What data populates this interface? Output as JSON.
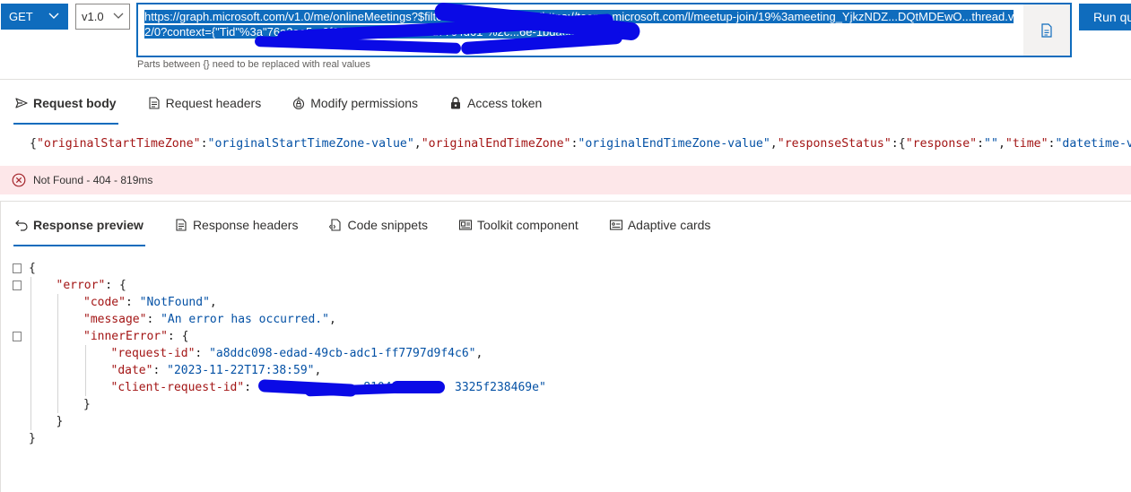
{
  "query_bar": {
    "method": "GET",
    "version": "v1.0",
    "url": "https://graph.microsoft.com/v1.0/me/onlineMeetings?$filter=JoinWebUrl+eq+'https://teams.microsoft.com/l/meetup-join/19%3ameeting_YjkzNDZ...DQtMDEwO...thread.v2/0?context={\"Tid\"%3a\"76a2ae5a-9f00-4f6b-95ed-5d33d77c4d61\"%2c...6e-1bdac35800dd\"}'",
    "hint": "Parts between {} need to be replaced with real values",
    "run_label": "Run query"
  },
  "request_tabs": [
    {
      "label": "Request body",
      "icon": "send-icon",
      "active": true
    },
    {
      "label": "Request headers",
      "icon": "document-icon",
      "active": false
    },
    {
      "label": "Modify permissions",
      "icon": "lock-shield-icon",
      "active": false
    },
    {
      "label": "Access token",
      "icon": "lock-icon",
      "active": false
    }
  ],
  "request_body": {
    "parts": [
      {
        "t": "{",
        "c": "p"
      },
      {
        "t": "\"originalStartTimeZone\"",
        "c": "k"
      },
      {
        "t": ":",
        "c": "p"
      },
      {
        "t": "\"originalStartTimeZone-value\"",
        "c": "s"
      },
      {
        "t": ",",
        "c": "p"
      },
      {
        "t": "\"originalEndTimeZone\"",
        "c": "k"
      },
      {
        "t": ":",
        "c": "p"
      },
      {
        "t": "\"originalEndTimeZone-value\"",
        "c": "s"
      },
      {
        "t": ",",
        "c": "p"
      },
      {
        "t": "\"responseStatus\"",
        "c": "k"
      },
      {
        "t": ":{",
        "c": "p"
      },
      {
        "t": "\"response\"",
        "c": "k"
      },
      {
        "t": ":",
        "c": "p"
      },
      {
        "t": "\"\"",
        "c": "s"
      },
      {
        "t": ",",
        "c": "p"
      },
      {
        "t": "\"time\"",
        "c": "k"
      },
      {
        "t": ":",
        "c": "p"
      },
      {
        "t": "\"datetime-value\"",
        "c": "s"
      }
    ]
  },
  "status": {
    "text": "Not Found - 404 - 819ms",
    "color": "#fde7e9"
  },
  "response_tabs": [
    {
      "label": "Response preview",
      "icon": "undo-arrow-icon",
      "active": true
    },
    {
      "label": "Response headers",
      "icon": "document-icon",
      "active": false
    },
    {
      "label": "Code snippets",
      "icon": "code-file-icon",
      "active": false
    },
    {
      "label": "Toolkit component",
      "icon": "toolkit-icon",
      "active": false
    },
    {
      "label": "Adaptive cards",
      "icon": "card-icon",
      "active": false
    }
  ],
  "response_json": {
    "lines": [
      {
        "indent": 0,
        "fold": true,
        "tokens": [
          {
            "t": "{",
            "c": "pun"
          }
        ]
      },
      {
        "indent": 1,
        "fold": true,
        "tokens": [
          {
            "t": "\"error\"",
            "c": "key"
          },
          {
            "t": ": {",
            "c": "pun"
          }
        ]
      },
      {
        "indent": 2,
        "fold": false,
        "tokens": [
          {
            "t": "\"code\"",
            "c": "key"
          },
          {
            "t": ": ",
            "c": "pun"
          },
          {
            "t": "\"NotFound\"",
            "c": "str"
          },
          {
            "t": ",",
            "c": "pun"
          }
        ]
      },
      {
        "indent": 2,
        "fold": false,
        "tokens": [
          {
            "t": "\"message\"",
            "c": "key"
          },
          {
            "t": ": ",
            "c": "pun"
          },
          {
            "t": "\"An error has occurred.\"",
            "c": "str"
          },
          {
            "t": ",",
            "c": "pun"
          }
        ]
      },
      {
        "indent": 2,
        "fold": true,
        "tokens": [
          {
            "t": "\"innerError\"",
            "c": "key"
          },
          {
            "t": ": {",
            "c": "pun"
          }
        ]
      },
      {
        "indent": 3,
        "fold": false,
        "tokens": [
          {
            "t": "\"request-id\"",
            "c": "key"
          },
          {
            "t": ": ",
            "c": "pun"
          },
          {
            "t": "\"a8ddc098-edad-49cb-adc1-ff7797d9f4c6\"",
            "c": "str"
          },
          {
            "t": ",",
            "c": "pun"
          }
        ]
      },
      {
        "indent": 3,
        "fold": false,
        "tokens": [
          {
            "t": "\"date\"",
            "c": "key"
          },
          {
            "t": ": ",
            "c": "pun"
          },
          {
            "t": "\"2023-11-22T17:38:59\"",
            "c": "str"
          },
          {
            "t": ",",
            "c": "pun"
          }
        ]
      },
      {
        "indent": 3,
        "fold": false,
        "tokens": [
          {
            "t": "\"client-request-id\"",
            "c": "key"
          },
          {
            "t": ": ",
            "c": "pun"
          },
          {
            "t": "\"a             8104         3325f238469e\"",
            "c": "str"
          }
        ]
      },
      {
        "indent": 2,
        "fold": false,
        "tokens": [
          {
            "t": "}",
            "c": "pun"
          }
        ]
      },
      {
        "indent": 1,
        "fold": false,
        "tokens": [
          {
            "t": "}",
            "c": "pun"
          }
        ]
      },
      {
        "indent": 0,
        "fold": false,
        "tokens": [
          {
            "t": "}",
            "c": "pun"
          }
        ]
      }
    ]
  },
  "colors": {
    "accent": "#0f6cbd",
    "error_bg": "#fde7e9",
    "json_key": "#a31515",
    "json_string": "#0451a5"
  }
}
